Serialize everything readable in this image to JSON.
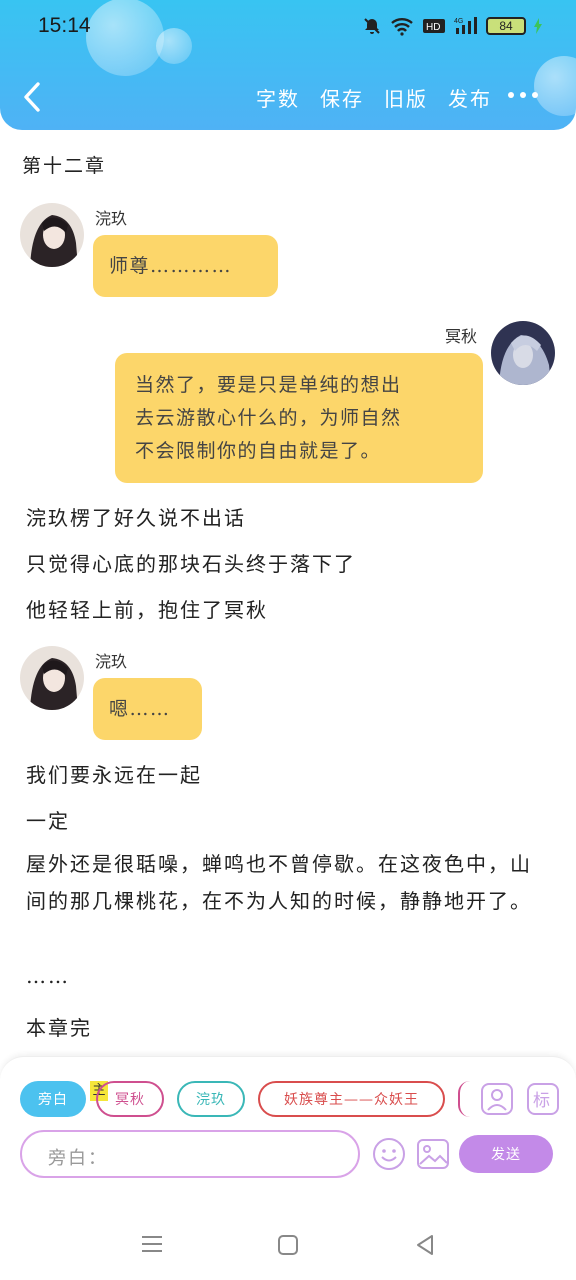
{
  "status_bar": {
    "time": "15:14",
    "battery": "84"
  },
  "toolbar": {
    "word_count": "字数",
    "save": "保存",
    "old_version": "旧版",
    "publish": "发布"
  },
  "chapter_title": "第十二章",
  "messages": [
    {
      "speaker": "浣玖",
      "text": "师尊…………"
    },
    {
      "speaker": "冥秋",
      "lines": [
        "当然了，要是只是单纯的想出",
        "去云游散心什么的，为师自然",
        "不会限制你的自由就是了。"
      ]
    },
    {
      "speaker": "浣玖",
      "text": "嗯……"
    }
  ],
  "narration": [
    "浣玖楞了好久说不出话",
    "只觉得心底的那块石头终于落下了",
    "他轻轻上前，抱住了冥秋",
    "我们要永远在一起",
    "一定",
    "屋外还是很聒噪，蝉鸣也不曾停歇。在这夜色中，山间的那几棵桃花，在不为人知的时候，静静地开了。",
    "……",
    "本章完"
  ],
  "roles": {
    "narrator": "旁白",
    "main_badge": "主",
    "items": [
      "冥秋",
      "浣玖",
      "妖族尊主——众妖王"
    ]
  },
  "input": {
    "label": "旁白：",
    "send": "发送"
  },
  "colors": {
    "header": "#4fb2f5",
    "bubble": "#fcd66a",
    "accent": "#c38ae8"
  }
}
